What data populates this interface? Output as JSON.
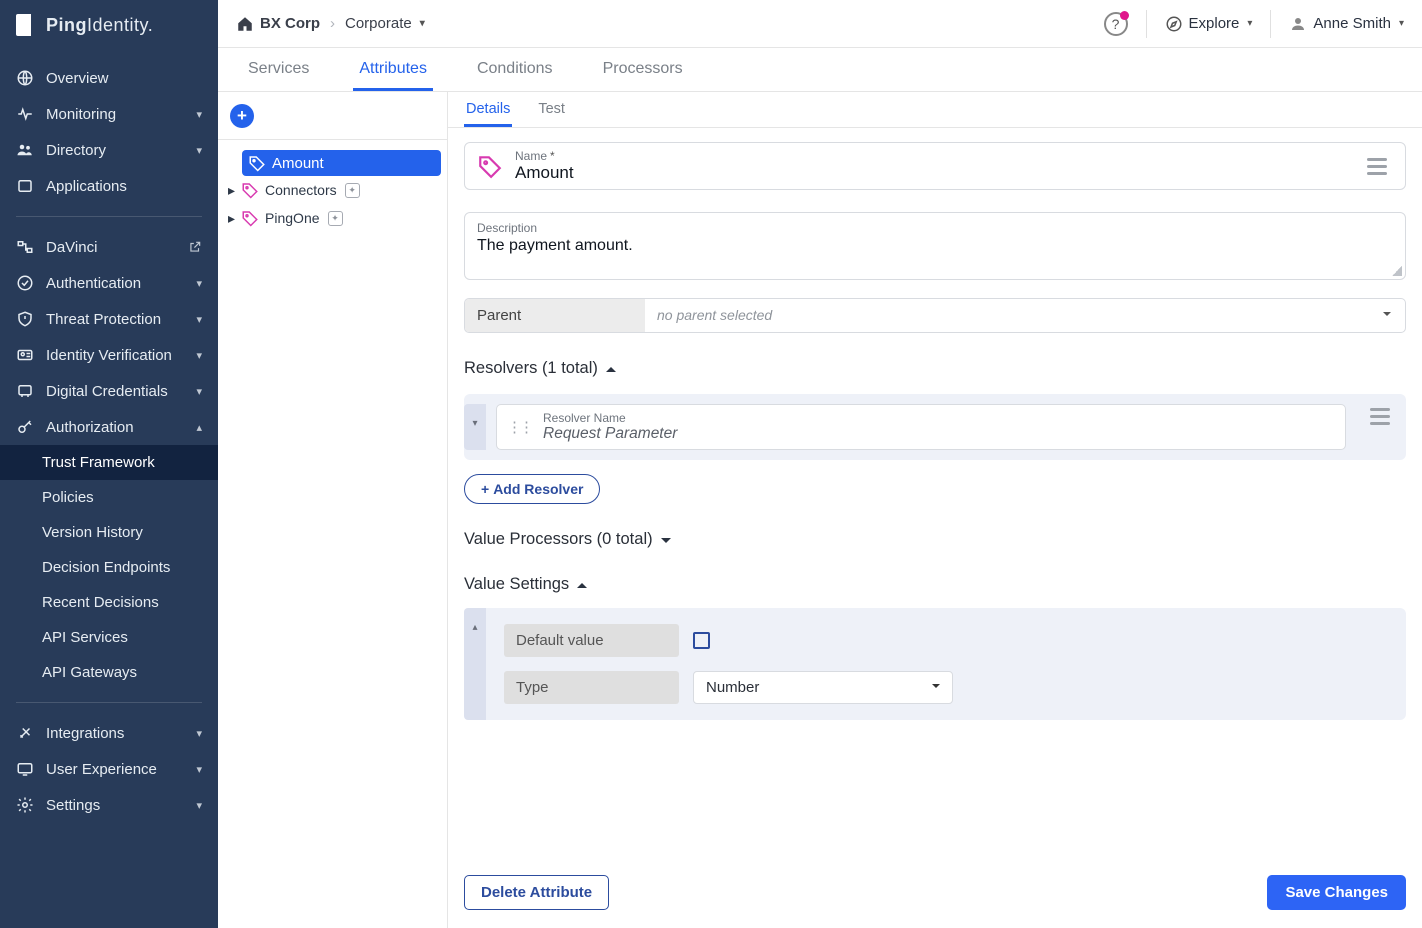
{
  "brand": "PingIdentity.",
  "breadcrumb": {
    "org": "BX Corp",
    "env": "Corporate"
  },
  "topbar": {
    "explore": "Explore",
    "user": "Anne Smith"
  },
  "sidebar": {
    "items": [
      {
        "label": "Overview"
      },
      {
        "label": "Monitoring",
        "chev": true
      },
      {
        "label": "Directory",
        "chev": true
      },
      {
        "label": "Applications"
      }
    ],
    "items2": [
      {
        "label": "DaVinci",
        "ext": true
      },
      {
        "label": "Authentication",
        "chev": true
      },
      {
        "label": "Threat Protection",
        "chev": true
      },
      {
        "label": "Identity Verification",
        "chev": true
      },
      {
        "label": "Digital Credentials",
        "chev": true
      },
      {
        "label": "Authorization",
        "chev": true,
        "open": true
      }
    ],
    "auth_sub": [
      {
        "label": "Trust Framework",
        "active": true
      },
      {
        "label": "Policies"
      },
      {
        "label": "Version History"
      },
      {
        "label": "Decision Endpoints"
      },
      {
        "label": "Recent Decisions"
      },
      {
        "label": "API Services"
      },
      {
        "label": "API Gateways"
      }
    ],
    "items3": [
      {
        "label": "Integrations",
        "chev": true
      },
      {
        "label": "User Experience",
        "chev": true
      },
      {
        "label": "Settings",
        "chev": true
      }
    ]
  },
  "tabs": [
    "Services",
    "Attributes",
    "Conditions",
    "Processors"
  ],
  "active_tab": 1,
  "tree": [
    {
      "label": "Amount",
      "selected": true
    },
    {
      "label": "Connectors",
      "lock": true,
      "caret": true
    },
    {
      "label": "PingOne",
      "lock": true,
      "caret": true
    }
  ],
  "detail_tabs": [
    "Details",
    "Test"
  ],
  "active_detail_tab": 0,
  "name_field": {
    "label": "Name",
    "value": "Amount"
  },
  "description": {
    "label": "Description",
    "value": "The payment amount."
  },
  "parent": {
    "label": "Parent",
    "value": "no parent selected"
  },
  "resolvers": {
    "title": "Resolvers (1 total)",
    "name_label": "Resolver Name",
    "name_value": "Request Parameter",
    "add_label": "Add Resolver"
  },
  "value_processors": {
    "title": "Value Processors (0 total)"
  },
  "value_settings": {
    "title": "Value Settings",
    "default_label": "Default value",
    "type_label": "Type",
    "type_value": "Number"
  },
  "actions": {
    "delete": "Delete Attribute",
    "save": "Save Changes"
  }
}
